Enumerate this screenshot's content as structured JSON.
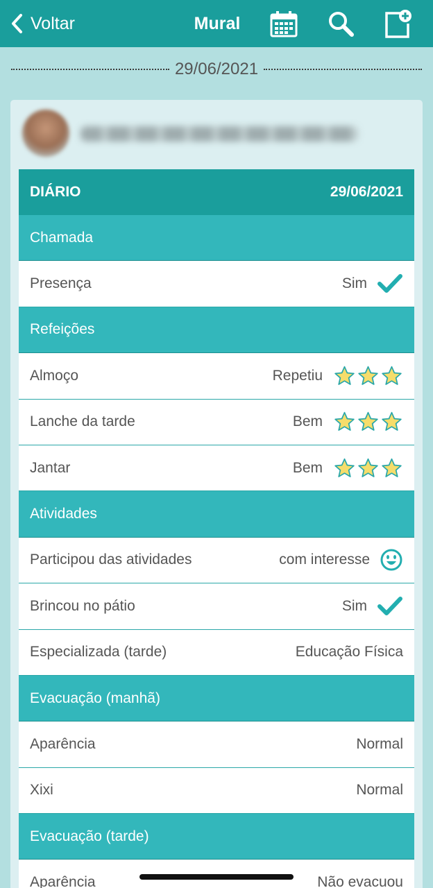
{
  "topbar": {
    "back_label": "Voltar",
    "title": "Mural",
    "icons": [
      "calendar-icon",
      "search-icon",
      "new-post-icon"
    ]
  },
  "date_separator": "29/06/2021",
  "diary": {
    "header_title": "DIÁRIO",
    "header_date": "29/06/2021",
    "sections": [
      {
        "title": "Chamada"
      },
      {
        "title": "Refeições"
      },
      {
        "title": "Atividades"
      },
      {
        "title": "Evacuação (manhã)"
      },
      {
        "title": "Evacuação (tarde)"
      }
    ],
    "rows": [
      {
        "label": "Presença",
        "value": "Sim",
        "icon": "check-icon"
      },
      {
        "label": "Almoço",
        "value": "Repetiu",
        "stars": 3
      },
      {
        "label": "Lanche da tarde",
        "value": "Bem",
        "stars": 3
      },
      {
        "label": "Jantar",
        "value": "Bem",
        "stars": 3
      },
      {
        "label": "Participou das atividades",
        "value": "com interesse",
        "icon": "smiley-icon"
      },
      {
        "label": "Brincou no pátio",
        "value": "Sim",
        "icon": "check-icon"
      },
      {
        "label": "Especializada (tarde)",
        "value": "Educação Física"
      },
      {
        "label": "Aparência",
        "value": "Normal"
      },
      {
        "label": "Xixi",
        "value": "Normal"
      },
      {
        "label": "Aparência",
        "value": "Não evacuou"
      }
    ]
  },
  "colors": {
    "header_teal": "#1a9e9c",
    "section_teal": "#33b7bb",
    "background": "#b3dfe0",
    "star_fill": "#f6dd6b"
  }
}
